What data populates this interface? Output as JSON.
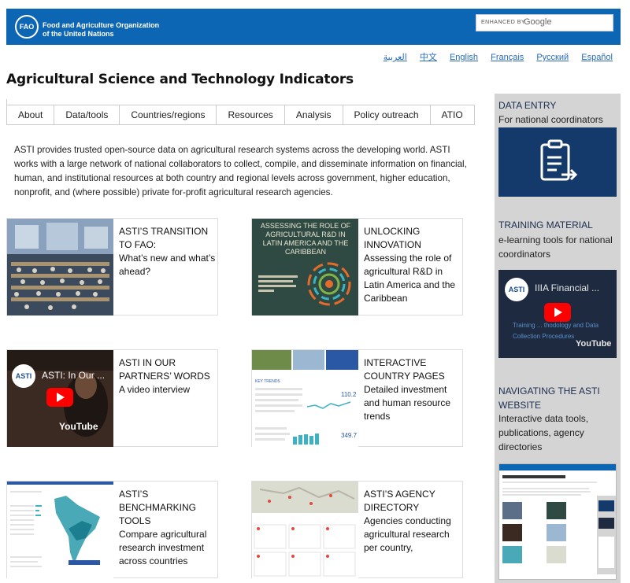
{
  "header": {
    "org_line1": "Food and Agriculture Organization",
    "org_line2": "of the United Nations",
    "logo_text": "FAO",
    "search_enhanced": "ENHANCED BY",
    "search_google": "Google"
  },
  "languages": [
    "العربية",
    "中文",
    "English",
    "Français",
    "Русский",
    "Español"
  ],
  "site_title": "Agricultural Science and Technology Indicators",
  "nav": [
    "About",
    "Data/tools",
    "Countries/regions",
    "Resources",
    "Analysis",
    "Policy outreach",
    "ATIO"
  ],
  "intro": "ASTI provides trusted open-source data on agricultural research systems across the developing world. ASTI works with a large network of national collaborators to collect, compile, and disseminate information on financial, human, and institutional resources at both country and regional levels across government, higher education, nonprofit, and (where possible) private for-profit agricultural research agencies.",
  "cards": [
    {
      "title": "ASTI’S TRANSITION TO FAO:",
      "desc": "What’s new and what’s ahead?"
    },
    {
      "title": "UNLOCKING INNOVATION",
      "desc": "Assessing the role of agricultural R&D in Latin America and the Caribbean"
    },
    {
      "title": "ASTI IN OUR PARTNERS’ WORDS",
      "desc": "A video interview"
    },
    {
      "title": "INTERACTIVE COUNTRY PAGES",
      "desc": "Detailed investment and human resource trends"
    },
    {
      "title": "ASTI’S BENCHMARKING TOOLS",
      "desc": "Compare agricultural research investment across countries"
    },
    {
      "title": "ASTI’S AGENCY DIRECTORY",
      "desc": "Agencies conducting agricultural research per country,"
    }
  ],
  "thumbs": {
    "report_title": "ASSESSING THE ROLE OF AGRICULTURAL R&D IN LATIN AMERICA AND THE CARIBBEAN",
    "video1_title": "ASTI: In Our ...",
    "youtube": "YouTube",
    "asti_badge": "ASTI",
    "country_value1": "110.2",
    "country_value2": "349.7",
    "key_trends": "KEY TRENDS"
  },
  "sidebar": {
    "data_entry_title": "DATA ENTRY",
    "data_entry_sub": "For national coordinators",
    "training_title": "TRAINING MATERIAL",
    "training_sub": "e-learning tools for national coordinators",
    "training_video_title": "IIIA Financial ...",
    "training_video_sub": "Training ... thodology and Data Collection Procedures",
    "nav_title": "NAVIGATING THE ASTI WEBSITE",
    "nav_sub": "Interactive data tools, publications, agency directories"
  },
  "colors": {
    "banner": "#0d66b4",
    "sidebar": "#d4d4d4",
    "data_entry_box": "#143a6b",
    "link": "#2a6bb5"
  }
}
